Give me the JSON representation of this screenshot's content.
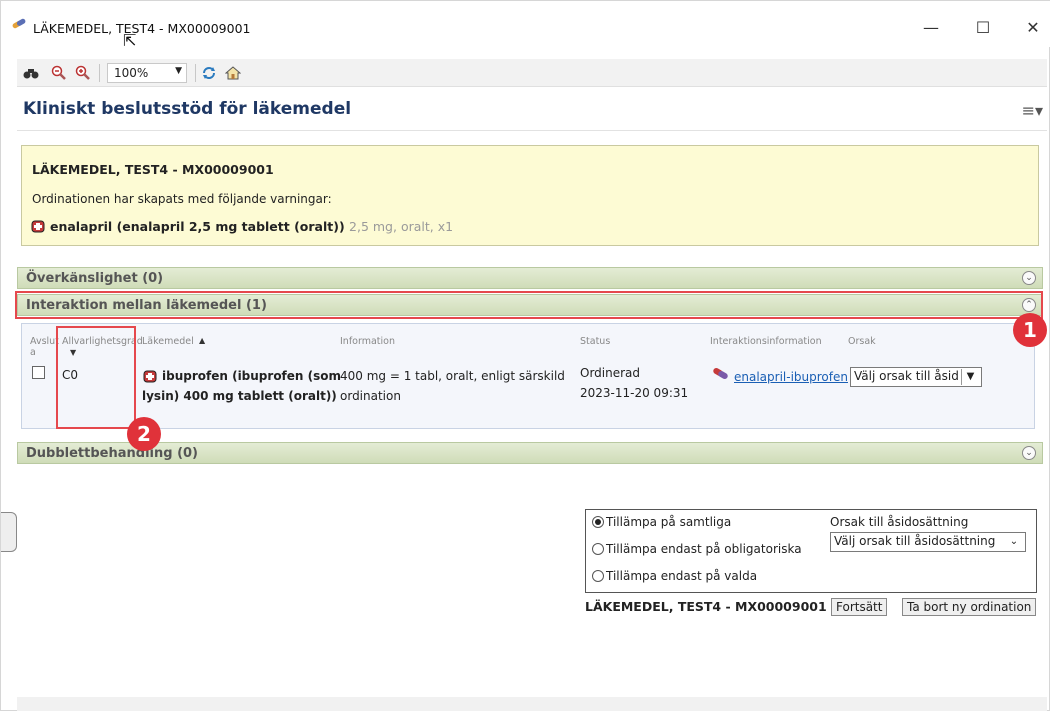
{
  "window": {
    "title": "LÄKEMEDEL, TEST4 - MX00009001"
  },
  "toolbar": {
    "zoom": "100%"
  },
  "header": {
    "title": "Kliniskt beslutsstöd för läkemedel"
  },
  "warning": {
    "patient": "LÄKEMEDEL, TEST4 - MX00009001",
    "message": "Ordinationen har skapats med följande varningar:",
    "drug_bold": "enalapril (enalapril 2,5 mg tablett (oralt))",
    "drug_detail": "2,5 mg, oralt, x1"
  },
  "sections": {
    "hypersensitivity": "Överkänslighet (0)",
    "interaction": "Interaktion mellan läkemedel (1)",
    "duplicate": "Dubblettbehandling (0)"
  },
  "table": {
    "headers": {
      "avslut": "Avslut a",
      "severity": "Allvarlighetsgrad",
      "drug": "Läkemedel",
      "info": "Information",
      "status": "Status",
      "interinfo": "Interaktionsinformation",
      "reason": "Orsak"
    },
    "row": {
      "severity": "C0",
      "drug": "ibuprofen (ibuprofen (som lysin) 400 mg tablett (oralt))",
      "info": "400 mg = 1 tabl, oralt, enligt särskild ordination",
      "status": "Ordinerad",
      "date": "2023-11-20 09:31",
      "link": "enalapril-ibuprofen",
      "reason": "Välj orsak till åsid"
    }
  },
  "badges": {
    "one": "1",
    "two": "2"
  },
  "bottom": {
    "radio1": "Tillämpa på samtliga",
    "radio2": "Tillämpa endast på obligatoriska",
    "radio3": "Tillämpa endast på valda",
    "reason_label": "Orsak till åsidosättning",
    "reason_select": "Välj orsak till åsidosättning",
    "patient": "LÄKEMEDEL, TEST4 - MX00009001",
    "continue": "Fortsätt",
    "remove": "Ta bort ny ordination"
  }
}
